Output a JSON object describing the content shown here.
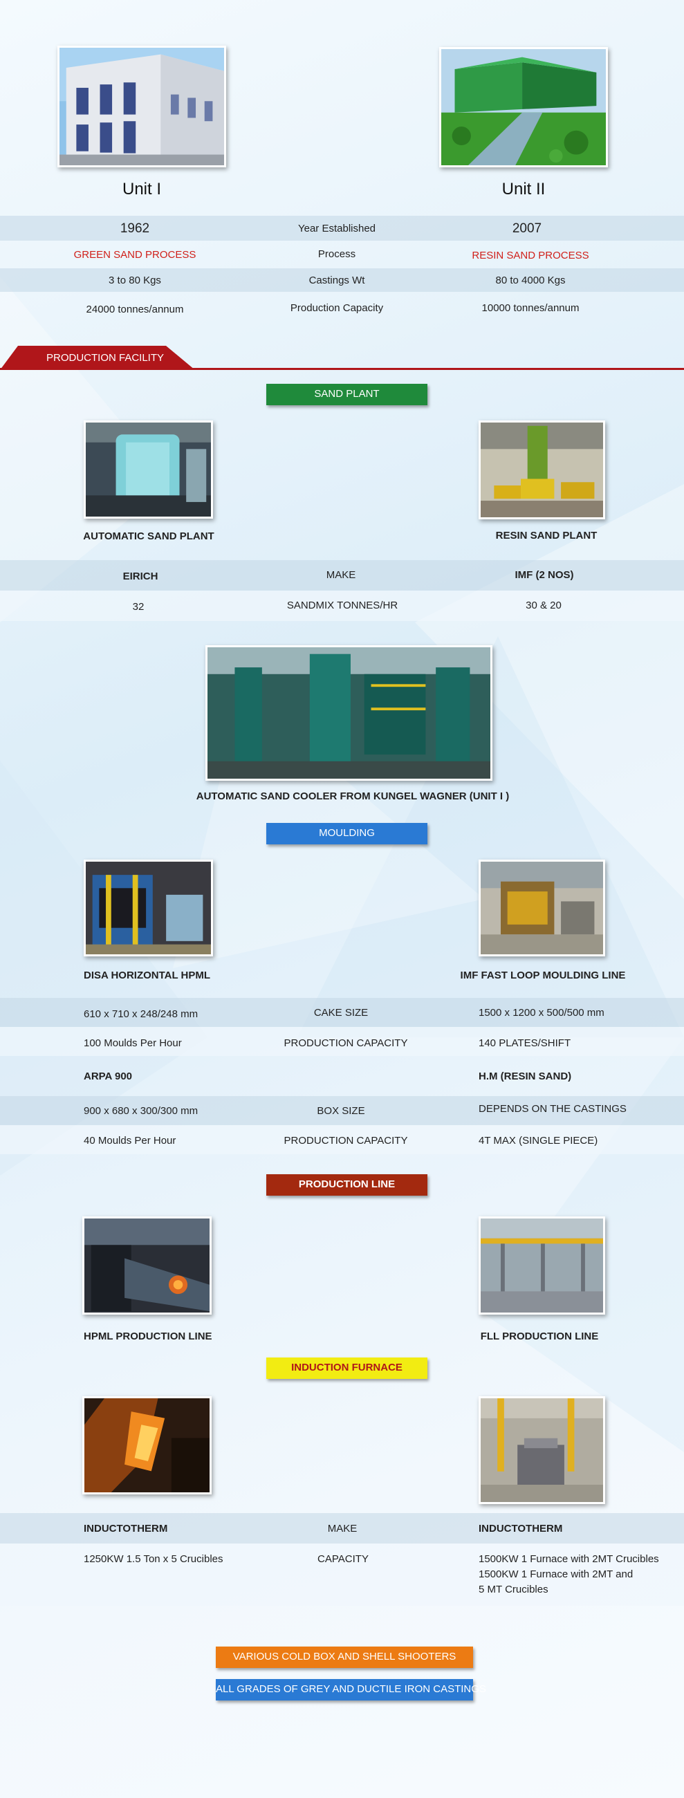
{
  "units": {
    "unit1": {
      "title": "Unit I"
    },
    "unit2": {
      "title": "Unit II"
    }
  },
  "unit_table": [
    {
      "left": "1962",
      "label": "Year Established",
      "right": "2007"
    },
    {
      "left": "GREEN SAND PROCESS",
      "label": "Process",
      "right": "RESIN SAND PROCESS"
    },
    {
      "left": "3 to 80 Kgs",
      "label": "Castings Wt",
      "right": "80 to 4000 Kgs"
    },
    {
      "left": "24000 tonnes/annum",
      "label": "Production Capacity",
      "right": "10000 tonnes/annum"
    }
  ],
  "production_facility": {
    "label": "PRODUCTION FACILITY"
  },
  "sand_plant": {
    "button": "SAND PLANT",
    "left_caption": "AUTOMATIC SAND PLANT",
    "right_caption": "RESIN SAND PLANT",
    "rows": [
      {
        "left": "EIRICH",
        "label": "MAKE",
        "right": "IMF (2 NOS)"
      },
      {
        "left": "32",
        "label": "SANDMIX TONNES/HR",
        "right": "30 & 20"
      }
    ],
    "cooler_caption": "AUTOMATIC SAND COOLER FROM KUNGEL WAGNER (UNIT I )"
  },
  "moulding": {
    "button": "MOULDING",
    "left_caption": "DISA HORIZONTAL HPML",
    "right_caption": "IMF FAST LOOP MOULDING LINE",
    "rows": [
      {
        "left": "610 x 710 x 248/248 mm",
        "label": "CAKE SIZE",
        "right": "1500 x 1200 x  500/500 mm"
      },
      {
        "left": "100 Moulds Per Hour",
        "label": "PRODUCTION CAPACITY",
        "right": "140 PLATES/SHIFT"
      },
      {
        "left": "ARPA 900",
        "label": "",
        "right": "H.M (RESIN SAND)"
      },
      {
        "left": "900 x 680 x 300/300 mm",
        "label": "BOX SIZE",
        "right": "DEPENDS ON THE CASTINGS"
      },
      {
        "left": "40 Moulds Per Hour",
        "label": "PRODUCTION CAPACITY",
        "right": "4T MAX (SINGLE PIECE)"
      }
    ]
  },
  "production_line": {
    "button": "PRODUCTION LINE",
    "left_caption": "HPML PRODUCTION LINE",
    "right_caption": "FLL PRODUCTION LINE"
  },
  "induction_furnace": {
    "button": "INDUCTION FURNACE",
    "rows": [
      {
        "left": "INDUCTOTHERM",
        "label": "MAKE",
        "right": "INDUCTOTHERM"
      },
      {
        "left": "1250KW 1.5 Ton x 5 Crucibles",
        "label": "CAPACITY",
        "right": "1500KW 1 Furnace with 2MT Crucibles",
        "right2": "1500KW 1 Furnace with 2MT and",
        "right3": " 5 MT Crucibles"
      }
    ]
  },
  "footer_buttons": {
    "orange": "VARIOUS COLD BOX AND SHELL SHOOTERS",
    "blue": "ALL GRADES OF GREY AND DUCTILE IRON CASTINGS"
  },
  "colors": {
    "green": "#1f8a3b",
    "blue": "#2a7ad4",
    "dark_red": "#a3290f",
    "yellow": "#f2ec12",
    "orange": "#ec7b13",
    "accent_red": "#b0161a"
  }
}
